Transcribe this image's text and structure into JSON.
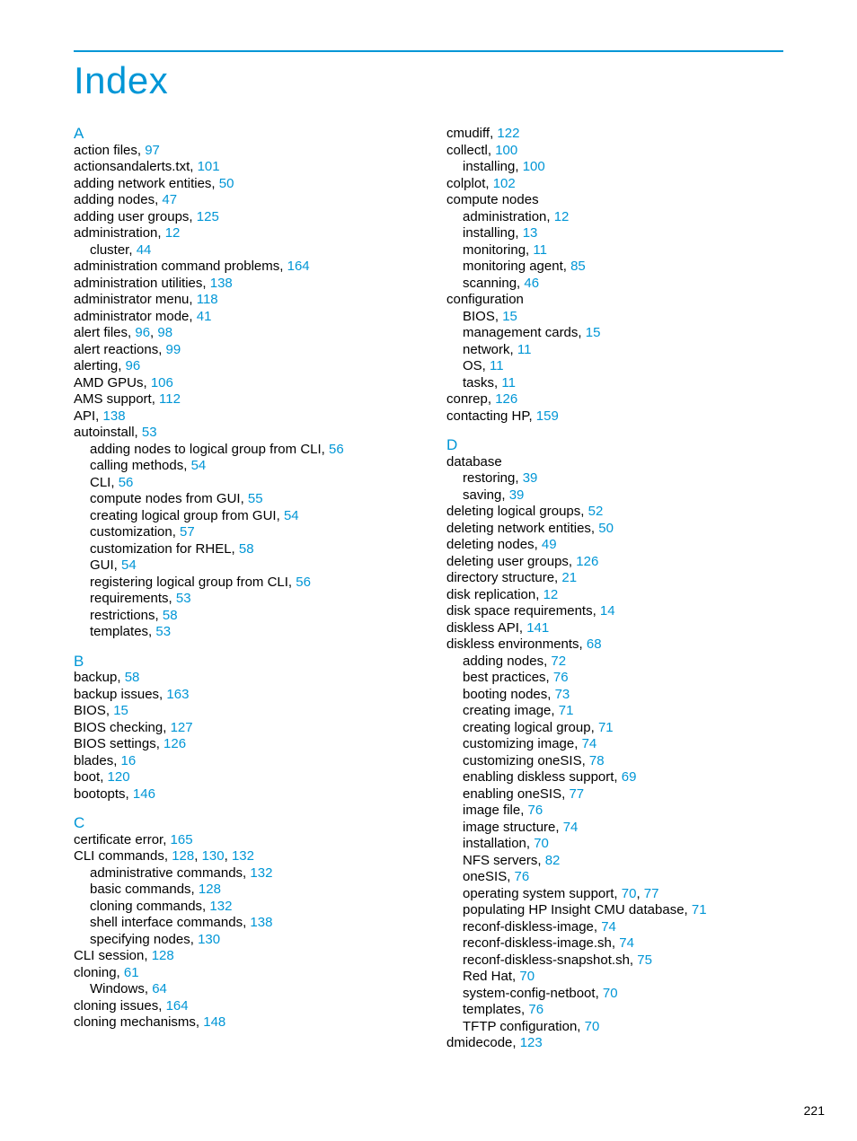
{
  "title": "Index",
  "page_number": "221",
  "columns": [
    [
      {
        "type": "letter",
        "text": "A"
      },
      {
        "type": "entry",
        "indent": 0,
        "text": "action files,",
        "refs": [
          "97"
        ]
      },
      {
        "type": "entry",
        "indent": 0,
        "text": "actionsandalerts.txt,",
        "refs": [
          "101"
        ]
      },
      {
        "type": "entry",
        "indent": 0,
        "text": "adding network entities,",
        "refs": [
          "50"
        ]
      },
      {
        "type": "entry",
        "indent": 0,
        "text": "adding nodes,",
        "refs": [
          "47"
        ]
      },
      {
        "type": "entry",
        "indent": 0,
        "text": "adding user groups,",
        "refs": [
          "125"
        ]
      },
      {
        "type": "entry",
        "indent": 0,
        "text": "administration,",
        "refs": [
          "12"
        ]
      },
      {
        "type": "entry",
        "indent": 1,
        "text": "cluster,",
        "refs": [
          "44"
        ]
      },
      {
        "type": "entry",
        "indent": 0,
        "text": "administration command problems,",
        "refs": [
          "164"
        ]
      },
      {
        "type": "entry",
        "indent": 0,
        "text": "administration utilities,",
        "refs": [
          "138"
        ]
      },
      {
        "type": "entry",
        "indent": 0,
        "text": "administrator menu,",
        "refs": [
          "118"
        ]
      },
      {
        "type": "entry",
        "indent": 0,
        "text": "administrator mode,",
        "refs": [
          "41"
        ]
      },
      {
        "type": "entry",
        "indent": 0,
        "text": "alert files,",
        "refs": [
          "96",
          "98"
        ]
      },
      {
        "type": "entry",
        "indent": 0,
        "text": "alert reactions,",
        "refs": [
          "99"
        ]
      },
      {
        "type": "entry",
        "indent": 0,
        "text": "alerting,",
        "refs": [
          "96"
        ]
      },
      {
        "type": "entry",
        "indent": 0,
        "text": "AMD GPUs,",
        "refs": [
          "106"
        ]
      },
      {
        "type": "entry",
        "indent": 0,
        "text": "AMS support,",
        "refs": [
          "112"
        ]
      },
      {
        "type": "entry",
        "indent": 0,
        "text": "API,",
        "refs": [
          "138"
        ]
      },
      {
        "type": "entry",
        "indent": 0,
        "text": "autoinstall,",
        "refs": [
          "53"
        ]
      },
      {
        "type": "entry",
        "indent": 1,
        "text": "adding nodes to logical group from CLI,",
        "refs": [
          "56"
        ]
      },
      {
        "type": "entry",
        "indent": 1,
        "text": "calling methods,",
        "refs": [
          "54"
        ]
      },
      {
        "type": "entry",
        "indent": 1,
        "text": "CLI,",
        "refs": [
          "56"
        ]
      },
      {
        "type": "entry",
        "indent": 1,
        "text": "compute nodes from GUI,",
        "refs": [
          "55"
        ]
      },
      {
        "type": "entry",
        "indent": 1,
        "text": "creating logical group from GUI,",
        "refs": [
          "54"
        ]
      },
      {
        "type": "entry",
        "indent": 1,
        "text": "customization,",
        "refs": [
          "57"
        ]
      },
      {
        "type": "entry",
        "indent": 1,
        "text": "customization for RHEL,",
        "refs": [
          "58"
        ]
      },
      {
        "type": "entry",
        "indent": 1,
        "text": "GUI,",
        "refs": [
          "54"
        ]
      },
      {
        "type": "entry",
        "indent": 1,
        "text": "registering logical group from CLI,",
        "refs": [
          "56"
        ]
      },
      {
        "type": "entry",
        "indent": 1,
        "text": "requirements,",
        "refs": [
          "53"
        ]
      },
      {
        "type": "entry",
        "indent": 1,
        "text": "restrictions,",
        "refs": [
          "58"
        ]
      },
      {
        "type": "entry",
        "indent": 1,
        "text": "templates,",
        "refs": [
          "53"
        ]
      },
      {
        "type": "letter",
        "text": "B"
      },
      {
        "type": "entry",
        "indent": 0,
        "text": "backup,",
        "refs": [
          "58"
        ]
      },
      {
        "type": "entry",
        "indent": 0,
        "text": "backup issues,",
        "refs": [
          "163"
        ]
      },
      {
        "type": "entry",
        "indent": 0,
        "text": "BIOS,",
        "refs": [
          "15"
        ]
      },
      {
        "type": "entry",
        "indent": 0,
        "text": "BIOS checking,",
        "refs": [
          "127"
        ]
      },
      {
        "type": "entry",
        "indent": 0,
        "text": "BIOS settings,",
        "refs": [
          "126"
        ]
      },
      {
        "type": "entry",
        "indent": 0,
        "text": "blades,",
        "refs": [
          "16"
        ]
      },
      {
        "type": "entry",
        "indent": 0,
        "text": "boot,",
        "refs": [
          "120"
        ]
      },
      {
        "type": "entry",
        "indent": 0,
        "text": "bootopts,",
        "refs": [
          "146"
        ]
      },
      {
        "type": "letter",
        "text": "C"
      },
      {
        "type": "entry",
        "indent": 0,
        "text": "certificate error,",
        "refs": [
          "165"
        ]
      },
      {
        "type": "entry",
        "indent": 0,
        "text": "CLI commands,",
        "refs": [
          "128",
          "130",
          "132"
        ]
      },
      {
        "type": "entry",
        "indent": 1,
        "text": "administrative commands,",
        "refs": [
          "132"
        ]
      },
      {
        "type": "entry",
        "indent": 1,
        "text": "basic commands,",
        "refs": [
          "128"
        ]
      },
      {
        "type": "entry",
        "indent": 1,
        "text": "cloning commands,",
        "refs": [
          "132"
        ]
      },
      {
        "type": "entry",
        "indent": 1,
        "text": "shell interface commands,",
        "refs": [
          "138"
        ]
      },
      {
        "type": "entry",
        "indent": 1,
        "text": "specifying nodes,",
        "refs": [
          "130"
        ]
      },
      {
        "type": "entry",
        "indent": 0,
        "text": "CLI session,",
        "refs": [
          "128"
        ]
      },
      {
        "type": "entry",
        "indent": 0,
        "text": "cloning,",
        "refs": [
          "61"
        ]
      },
      {
        "type": "entry",
        "indent": 1,
        "text": "Windows,",
        "refs": [
          "64"
        ]
      },
      {
        "type": "entry",
        "indent": 0,
        "text": "cloning issues,",
        "refs": [
          "164"
        ]
      },
      {
        "type": "entry",
        "indent": 0,
        "text": "cloning mechanisms,",
        "refs": [
          "148"
        ]
      }
    ],
    [
      {
        "type": "entry",
        "indent": 0,
        "text": "cmudiff,",
        "refs": [
          "122"
        ]
      },
      {
        "type": "entry",
        "indent": 0,
        "text": "collectl,",
        "refs": [
          "100"
        ]
      },
      {
        "type": "entry",
        "indent": 1,
        "text": "installing,",
        "refs": [
          "100"
        ]
      },
      {
        "type": "entry",
        "indent": 0,
        "text": "colplot,",
        "refs": [
          "102"
        ]
      },
      {
        "type": "entry",
        "indent": 0,
        "text": "compute nodes",
        "refs": []
      },
      {
        "type": "entry",
        "indent": 1,
        "text": "administration,",
        "refs": [
          "12"
        ]
      },
      {
        "type": "entry",
        "indent": 1,
        "text": "installing,",
        "refs": [
          "13"
        ]
      },
      {
        "type": "entry",
        "indent": 1,
        "text": "monitoring,",
        "refs": [
          "11"
        ]
      },
      {
        "type": "entry",
        "indent": 1,
        "text": "monitoring agent,",
        "refs": [
          "85"
        ]
      },
      {
        "type": "entry",
        "indent": 1,
        "text": "scanning,",
        "refs": [
          "46"
        ]
      },
      {
        "type": "entry",
        "indent": 0,
        "text": "configuration",
        "refs": []
      },
      {
        "type": "entry",
        "indent": 1,
        "text": "BIOS,",
        "refs": [
          "15"
        ]
      },
      {
        "type": "entry",
        "indent": 1,
        "text": "management cards,",
        "refs": [
          "15"
        ]
      },
      {
        "type": "entry",
        "indent": 1,
        "text": "network,",
        "refs": [
          "11"
        ]
      },
      {
        "type": "entry",
        "indent": 1,
        "text": "OS,",
        "refs": [
          "11"
        ]
      },
      {
        "type": "entry",
        "indent": 1,
        "text": "tasks,",
        "refs": [
          "11"
        ]
      },
      {
        "type": "entry",
        "indent": 0,
        "text": "conrep,",
        "refs": [
          "126"
        ]
      },
      {
        "type": "entry",
        "indent": 0,
        "text": "contacting HP,",
        "refs": [
          "159"
        ]
      },
      {
        "type": "letter",
        "text": "D"
      },
      {
        "type": "entry",
        "indent": 0,
        "text": "database",
        "refs": []
      },
      {
        "type": "entry",
        "indent": 1,
        "text": "restoring,",
        "refs": [
          "39"
        ]
      },
      {
        "type": "entry",
        "indent": 1,
        "text": "saving,",
        "refs": [
          "39"
        ]
      },
      {
        "type": "entry",
        "indent": 0,
        "text": "deleting logical groups,",
        "refs": [
          "52"
        ]
      },
      {
        "type": "entry",
        "indent": 0,
        "text": "deleting network entities,",
        "refs": [
          "50"
        ]
      },
      {
        "type": "entry",
        "indent": 0,
        "text": "deleting nodes,",
        "refs": [
          "49"
        ]
      },
      {
        "type": "entry",
        "indent": 0,
        "text": "deleting user groups,",
        "refs": [
          "126"
        ]
      },
      {
        "type": "entry",
        "indent": 0,
        "text": "directory structure,",
        "refs": [
          "21"
        ]
      },
      {
        "type": "entry",
        "indent": 0,
        "text": "disk replication,",
        "refs": [
          "12"
        ]
      },
      {
        "type": "entry",
        "indent": 0,
        "text": "disk space requirements,",
        "refs": [
          "14"
        ]
      },
      {
        "type": "entry",
        "indent": 0,
        "text": "diskless API,",
        "refs": [
          "141"
        ]
      },
      {
        "type": "entry",
        "indent": 0,
        "text": "diskless environments,",
        "refs": [
          "68"
        ]
      },
      {
        "type": "entry",
        "indent": 1,
        "text": "adding nodes,",
        "refs": [
          "72"
        ]
      },
      {
        "type": "entry",
        "indent": 1,
        "text": "best practices,",
        "refs": [
          "76"
        ]
      },
      {
        "type": "entry",
        "indent": 1,
        "text": "booting nodes,",
        "refs": [
          "73"
        ]
      },
      {
        "type": "entry",
        "indent": 1,
        "text": "creating image,",
        "refs": [
          "71"
        ]
      },
      {
        "type": "entry",
        "indent": 1,
        "text": "creating logical group,",
        "refs": [
          "71"
        ]
      },
      {
        "type": "entry",
        "indent": 1,
        "text": "customizing image,",
        "refs": [
          "74"
        ]
      },
      {
        "type": "entry",
        "indent": 1,
        "text": "customizing oneSIS,",
        "refs": [
          "78"
        ]
      },
      {
        "type": "entry",
        "indent": 1,
        "text": "enabling diskless support,",
        "refs": [
          "69"
        ]
      },
      {
        "type": "entry",
        "indent": 1,
        "text": "enabling oneSIS,",
        "refs": [
          "77"
        ]
      },
      {
        "type": "entry",
        "indent": 1,
        "text": "image file,",
        "refs": [
          "76"
        ]
      },
      {
        "type": "entry",
        "indent": 1,
        "text": "image structure,",
        "refs": [
          "74"
        ]
      },
      {
        "type": "entry",
        "indent": 1,
        "text": "installation,",
        "refs": [
          "70"
        ]
      },
      {
        "type": "entry",
        "indent": 1,
        "text": "NFS servers,",
        "refs": [
          "82"
        ]
      },
      {
        "type": "entry",
        "indent": 1,
        "text": "oneSIS,",
        "refs": [
          "76"
        ]
      },
      {
        "type": "entry",
        "indent": 1,
        "text": "operating system support,",
        "refs": [
          "70",
          "77"
        ]
      },
      {
        "type": "entry",
        "indent": 1,
        "text": "populating HP Insight CMU database,",
        "refs": [
          "71"
        ]
      },
      {
        "type": "entry",
        "indent": 1,
        "text": "reconf-diskless-image,",
        "refs": [
          "74"
        ]
      },
      {
        "type": "entry",
        "indent": 1,
        "text": "reconf-diskless-image.sh,",
        "refs": [
          "74"
        ]
      },
      {
        "type": "entry",
        "indent": 1,
        "text": "reconf-diskless-snapshot.sh,",
        "refs": [
          "75"
        ]
      },
      {
        "type": "entry",
        "indent": 1,
        "text": "Red Hat,",
        "refs": [
          "70"
        ]
      },
      {
        "type": "entry",
        "indent": 1,
        "text": "system-config-netboot,",
        "refs": [
          "70"
        ]
      },
      {
        "type": "entry",
        "indent": 1,
        "text": "templates,",
        "refs": [
          "76"
        ]
      },
      {
        "type": "entry",
        "indent": 1,
        "text": "TFTP configuration,",
        "refs": [
          "70"
        ]
      },
      {
        "type": "entry",
        "indent": 0,
        "text": "dmidecode,",
        "refs": [
          "123"
        ]
      }
    ]
  ]
}
